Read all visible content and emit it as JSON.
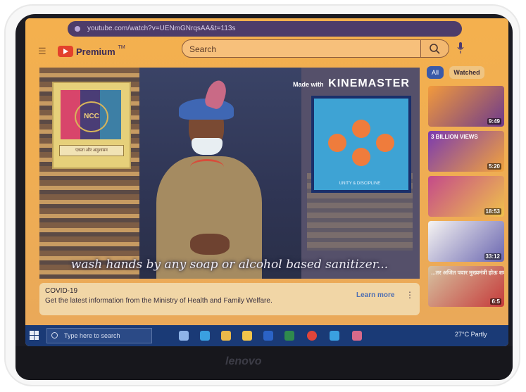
{
  "browser": {
    "url": "youtube.com/watch?v=UENmGNrqsAA&t=113s"
  },
  "youtube": {
    "logo_text": "Premium",
    "logo_tm": "TM",
    "search_placeholder": "Search"
  },
  "video": {
    "watermark_prefix": "Made with",
    "watermark_brand": "KINEMASTER",
    "subtitle": "wash hands by any soap or alcohol based sanitizer...",
    "flag_emblem": "NCC",
    "flag_banner": "एकता और अनुशासन",
    "poster_caption": "UNITY & DISCIPLINE"
  },
  "info_card": {
    "title": "COVID-19",
    "text": "Get the latest information from the Ministry of Health and Family Welfare.",
    "learn_more": "Learn more",
    "more_icon": "vertical-dots-icon"
  },
  "filter_chips": {
    "all": "All",
    "watched": "Watched"
  },
  "sidebar_videos": [
    {
      "overlay": "",
      "duration": "9:49"
    },
    {
      "overlay": "3 BILLION VIEWS",
      "duration": "5:20"
    },
    {
      "overlay": "",
      "duration": "18:53"
    },
    {
      "overlay": "",
      "duration": "33:12"
    },
    {
      "overlay": "...तर अजित पवार मुख्यमंत्री होऊ शकतील",
      "duration": "6:5"
    }
  ],
  "taskbar": {
    "search_placeholder": "Type here to search",
    "weather": "27°C  Partly"
  },
  "laptop": {
    "brand": "lenovo"
  }
}
